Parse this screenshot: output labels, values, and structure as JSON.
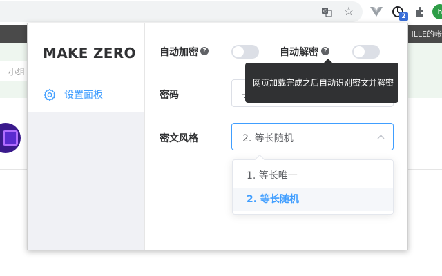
{
  "browser": {
    "bookmark_bar_text": "ILLE的帐",
    "page_search_placeholder": "小组",
    "extension_badge_count": "2",
    "profile_initial": "h",
    "icons": [
      "translate-icon",
      "star-icon",
      "vue-devtools-icon",
      "clock-extension-icon",
      "puzzle-icon"
    ]
  },
  "popup": {
    "brand": "MAKE ZERO",
    "sidebar": {
      "items": [
        {
          "label": "设置面板",
          "icon": "gear-icon"
        }
      ]
    },
    "auto_encrypt": {
      "label": "自动加密",
      "help": "?",
      "on": false
    },
    "auto_decrypt": {
      "label": "自动解密",
      "help": "?",
      "on": false
    },
    "password": {
      "label": "密码",
      "value": "手"
    },
    "cipher_style": {
      "label": "密文风格",
      "selected": "2. 等长随机",
      "options": [
        "1. 等长唯一",
        "2. 等长随机"
      ]
    },
    "tooltip": "网页加载完成之后自动识别密文并解密"
  },
  "colors": {
    "accent": "#409eff",
    "tooltip_bg": "#303133",
    "switch_off": "#dcdfe6",
    "sidebar_bg": "#f0f1f5"
  }
}
